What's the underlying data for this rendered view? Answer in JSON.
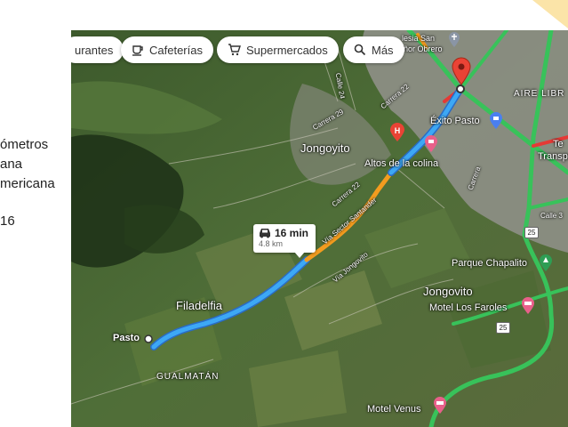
{
  "slide": {
    "lines": [
      "ómetros",
      "ana",
      "mericana",
      "16"
    ]
  },
  "chips": [
    {
      "label": "urantes",
      "icon": "restaurant-icon"
    },
    {
      "label": "Cafeterías",
      "icon": "coffee-icon"
    },
    {
      "label": "Supermercados",
      "icon": "cart-icon"
    },
    {
      "label": "Más",
      "icon": "search-icon"
    }
  ],
  "route": {
    "time": "16 min",
    "distance": "4.8 km"
  },
  "places": {
    "jongoyito_n": "Jongoyito",
    "altos": "Altos de la colina",
    "exito": "Éxito Pasto",
    "aire_libre": "AIRE LIBR",
    "transporte": "Transporte",
    "te": "Te",
    "filadelfia": "Filadelfia",
    "pasto": "Pasto",
    "gualmatan": "GUALMATÁN",
    "parque": "Parque Chapalito",
    "jongovito_s": "Jongovito",
    "motel_faroles": "Motel Los Faroles",
    "motel_venus": "Motel Venus",
    "iglesia": "lesia San",
    "obrero": "ñor Obrero",
    "carrera22": "Carrera 22",
    "carrera22a": "Carrera 22",
    "carrera29": "Carrera 29",
    "calle24": "Calle 24",
    "via_sector": "Vía Sector Santander",
    "via_jong": "Vía Jongovito",
    "carr_small": "Carrera",
    "calle_small": "Calle 3"
  },
  "road_shields": [
    "25",
    "25"
  ],
  "colors": {
    "route": "#3da8f5",
    "traffic_green": "#38c25a",
    "traffic_orange": "#f39c1f",
    "traffic_red": "#e53935",
    "pin_red": "#ea4335"
  }
}
